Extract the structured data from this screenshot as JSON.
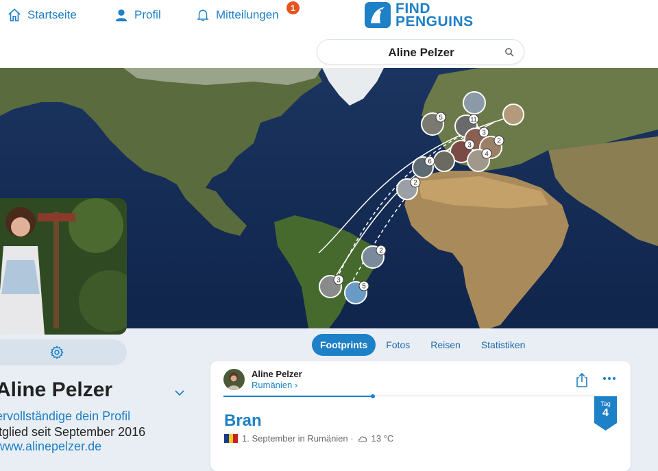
{
  "nav": {
    "home": "Startseite",
    "profile": "Profil",
    "notifications": "Mitteilungen",
    "notification_count": "1"
  },
  "logo": {
    "line1": "FIND",
    "line2": "PENGUINS"
  },
  "search": {
    "value": "Aline Pelzer"
  },
  "map": {
    "pins": [
      "5",
      "11",
      "3",
      "2",
      "3",
      "4",
      "6",
      "2",
      "2",
      "3",
      "5"
    ]
  },
  "profile": {
    "name": "Aline Pelzer",
    "complete_link": "ervollständige dein Profil",
    "member_since": "itglied seit September 2016",
    "website": "www.alinepelzer.de"
  },
  "tabs": [
    "Footprints",
    "Fotos",
    "Reisen",
    "Statistiken"
  ],
  "active_tab": "Footprints",
  "footprint": {
    "author": "Aline Pelzer",
    "country_link": "Rumänien ›",
    "progress": 0.4,
    "title": "Bran",
    "date": "1. September in Rumänien ·",
    "temperature": "13 °C",
    "day_label": "Tag",
    "day_number": "4"
  },
  "colors": {
    "accent": "#1e80c6",
    "badge": "#e8531f"
  }
}
